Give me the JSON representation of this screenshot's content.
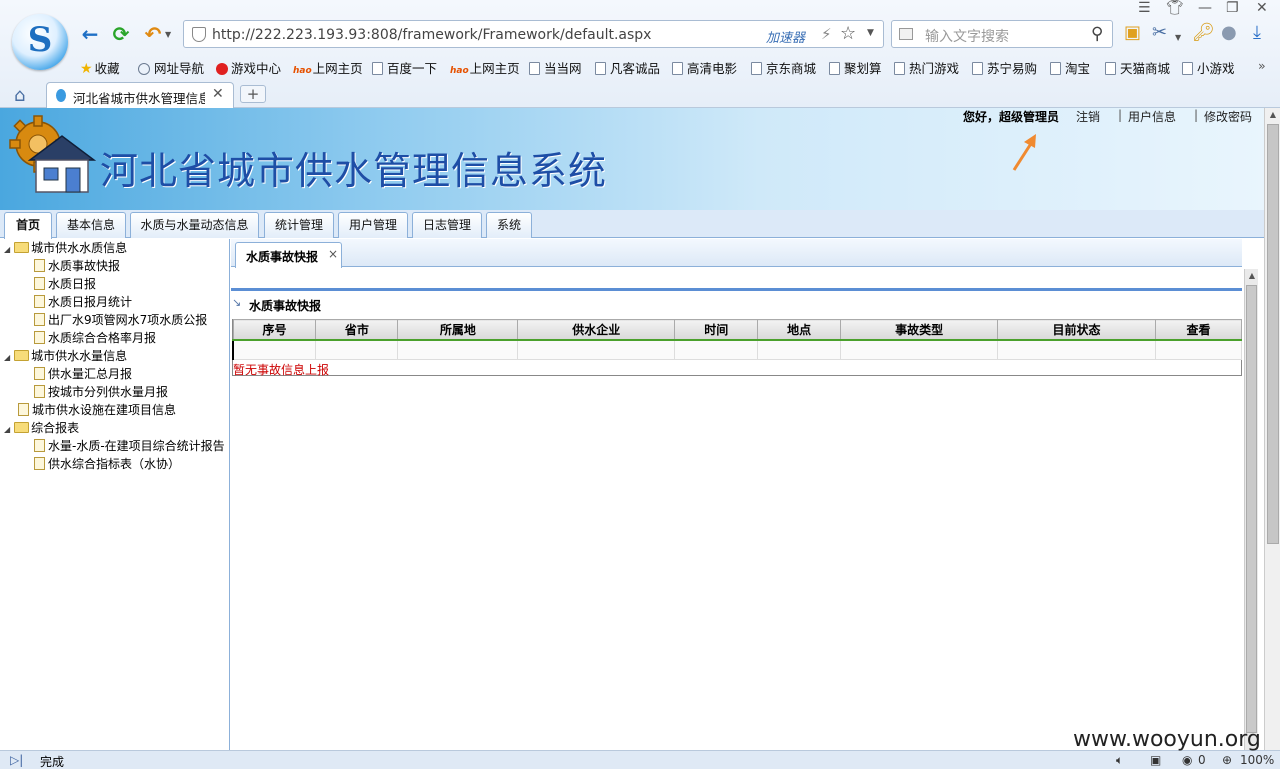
{
  "browser": {
    "logo_letter": "S",
    "url": "http://222.223.193.93:808/framework/Framework/default.aspx",
    "accelerator_label": "加速器",
    "search_placeholder": "输入文字搜索",
    "tab_title": "河北省城市供水管理信息",
    "new_tab_label": "+",
    "bookmarks": [
      "收藏",
      "网址导航",
      "游戏中心",
      "上网主页",
      "百度一下",
      "上网主页",
      "当当网",
      "凡客诚品",
      "高清电影",
      "京东商城",
      "聚划算",
      "热门游戏",
      "苏宁易购",
      "淘宝",
      "天猫商城",
      "小游戏"
    ],
    "hao_badge": "hao",
    "status_text": "完成",
    "zoom": "100%",
    "status_count": "0",
    "watermark": "www.wooyun.org"
  },
  "header": {
    "title": "河北省城市供水管理信息系统",
    "greeting": "您好，超级管理员",
    "links": [
      "注销",
      "用户信息",
      "修改密码"
    ],
    "separator": "|"
  },
  "menu": {
    "tabs": [
      "首页",
      "基本信息",
      "水质与水量动态信息",
      "统计管理",
      "用户管理",
      "日志管理",
      "系统"
    ],
    "active_index": 0
  },
  "tree": {
    "nodes": [
      {
        "label": "城市供水水质信息",
        "type": "folder"
      },
      {
        "label": "水质事故快报",
        "type": "doc"
      },
      {
        "label": "水质日报",
        "type": "doc"
      },
      {
        "label": "水质日报月统计",
        "type": "doc"
      },
      {
        "label": "出厂水9项管网水7项水质公报",
        "type": "doc"
      },
      {
        "label": "水质综合合格率月报",
        "type": "doc"
      },
      {
        "label": "城市供水水量信息",
        "type": "folder"
      },
      {
        "label": "供水量汇总月报",
        "type": "doc"
      },
      {
        "label": "按城市分列供水量月报",
        "type": "doc"
      },
      {
        "label": "城市供水设施在建项目信息",
        "type": "doc"
      },
      {
        "label": "综合报表",
        "type": "folder"
      },
      {
        "label": "水量-水质-在建项目综合统计报告",
        "type": "doc"
      },
      {
        "label": "供水综合指标表（水协）",
        "type": "doc"
      }
    ]
  },
  "content": {
    "tab_label": "水质事故快报",
    "tab_close": "×",
    "section_title": "水质事故快报",
    "table": {
      "columns": [
        "序号",
        "省市",
        "所属地",
        "供水企业",
        "时间",
        "地点",
        "事故类型",
        "目前状态",
        "查看"
      ]
    },
    "empty_message": "暂无事故信息上报"
  }
}
